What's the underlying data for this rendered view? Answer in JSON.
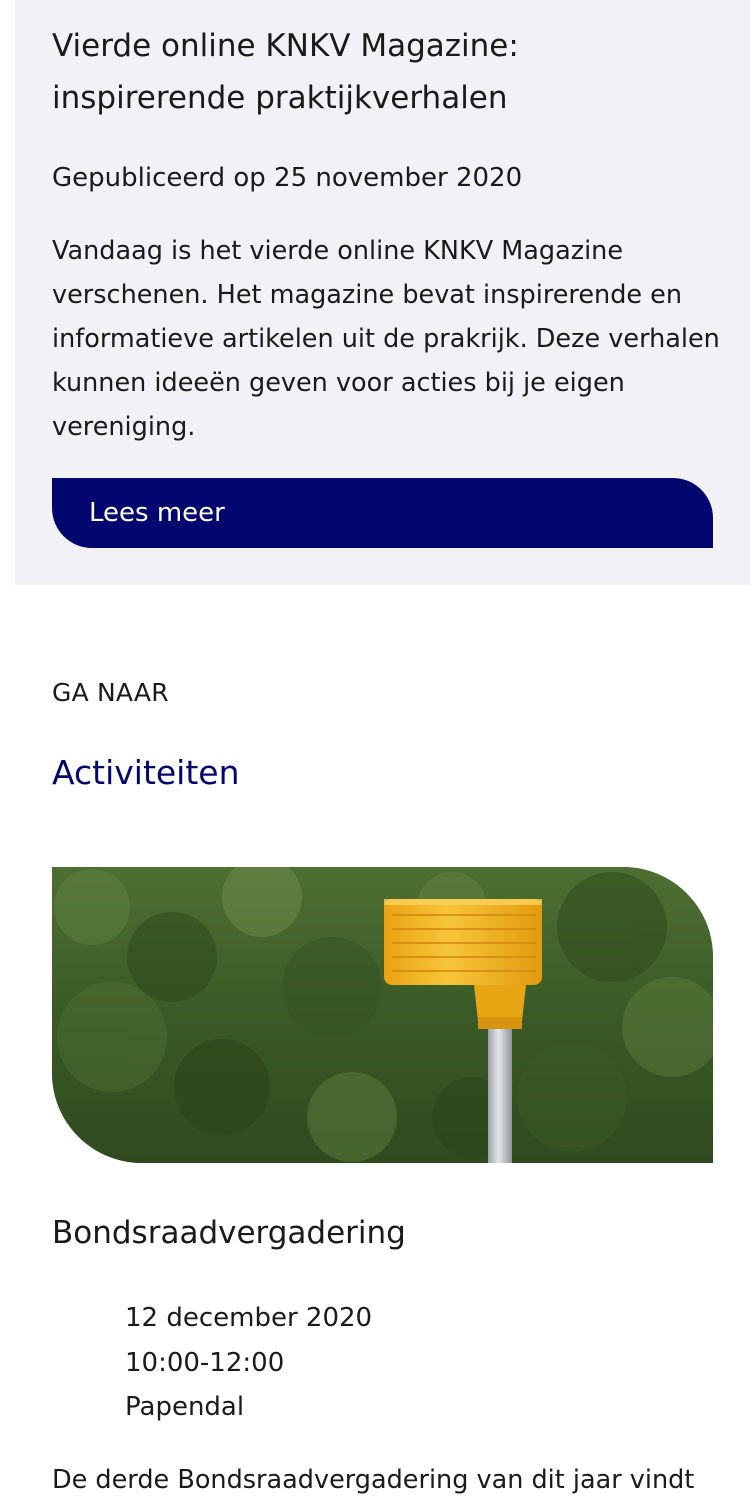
{
  "news": {
    "title": "Vierde online KNKV Magazine: inspirerende praktijkverhalen",
    "published": "Gepubliceerd op 25 november 2020",
    "body": "Vandaag is het vierde online KNKV Magazine verschenen. Het magazine bevat inspirerende en informatieve artikelen uit de prakrijk. Deze verhalen kunnen ideeën geven voor acties bij je eigen vereniging.",
    "read_more_label": "Lees meer"
  },
  "goto": {
    "label": "GA NAAR",
    "link_label": "Activiteiten"
  },
  "event": {
    "image_icon": "korfball-basket-photo",
    "title": "Bondsraadvergadering",
    "date": "12 december 2020",
    "time": "10:00-12:00",
    "location": "Papendal",
    "description": "De derde Bondsraadvergadering van dit jaar vindt"
  },
  "colors": {
    "accent": "#020770",
    "card_background": "#f1f1f6",
    "text": "#1a1a1a",
    "basket_yellow": "#f2b21b"
  }
}
